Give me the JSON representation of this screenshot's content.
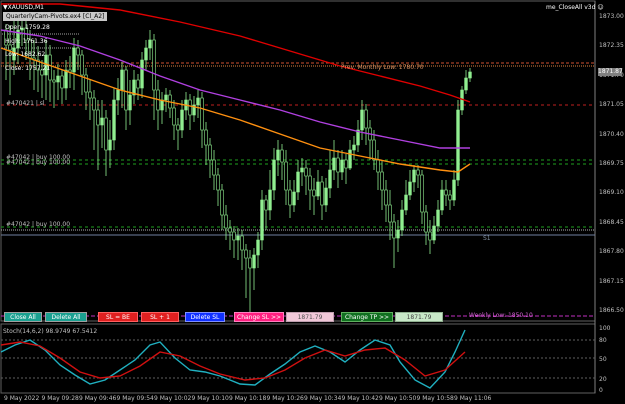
{
  "chart_header": {
    "symbol_label": "▼XAUUSD,M1",
    "indicator_label": "QuarterlyCam-Pivots.ex4",
    "indicator_sub": "[Cl_A2]",
    "ea_name": "me_CloseAll v3d",
    "ea_smile_icon": "smiley-icon"
  },
  "ohlc": {
    "open": "Open: 1759.28",
    "high": "High: 1761.36",
    "low": "Low: 1682.62",
    "close": "Close: 1757.21"
  },
  "levels": {
    "prev_monthly_low": "Prev. Monthly Low: 1780.70",
    "weekly_low": "Weekly Low: 1850.10",
    "s1": "S1",
    "order1": "#470421 |  sl",
    "order2": "#47042 | buy  100.00",
    "order3": "#47042 | buy  100.00",
    "order4": "#47042 | buy  100.00"
  },
  "price_axis": {
    "labels": [
      "1873.00",
      "1872.35",
      "1871.70",
      "1871.05",
      "1870.40",
      "1869.75",
      "1869.10",
      "1868.45",
      "1867.80",
      "1867.15",
      "1866.50"
    ],
    "current_price": "1871.87",
    "current_color": "#808080"
  },
  "stoch_axis": {
    "labels": [
      "100",
      "80",
      "50",
      "20",
      "0"
    ]
  },
  "stoch_label": "Stoch(14,6,2) 98.9749 67.5412",
  "time_axis": {
    "labels": [
      "9 May 2022",
      "9 May 09:28",
      "9 May 09:46",
      "9 May 09:54",
      "9 May 10:02",
      "9 May 10:10",
      "9 May 10:18",
      "9 May 10:26",
      "9 May 10:34",
      "9 May 10:42",
      "9 May 10:50",
      "9 May 10:58",
      "9 May 11:06"
    ]
  },
  "buttons": {
    "close_all": "Close All",
    "delete_all": "Delete All",
    "sl_be": "SL = BE",
    "sl_plus": "SL + 1",
    "delete_sl": "Delete SL",
    "change_sl": "Change SL >>",
    "sl_value": "1871.79",
    "change_tp": "Change TP >>",
    "tp_value": "1871.79"
  },
  "colors": {
    "background": "#000000",
    "bull_candle": "#90ee90",
    "bear_candle": "#000000",
    "ma_red": "#e00000",
    "ma_purple": "#b040e0",
    "ma_orange": "#ff9010",
    "stoch_main": "#20b0c0",
    "stoch_signal": "#d01010"
  }
}
